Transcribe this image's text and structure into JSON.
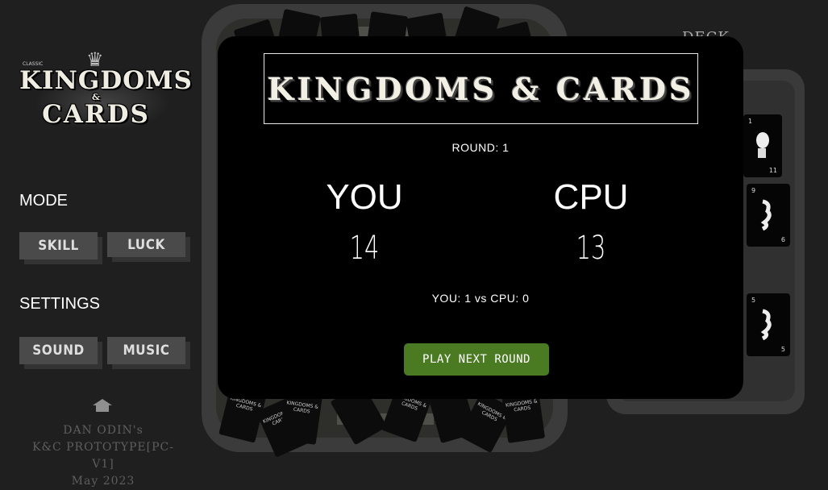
{
  "logo": {
    "tiny": "CLASSIC",
    "line1": "KINGDOMS",
    "line2": "&",
    "line3": "CARDS"
  },
  "sidebar": {
    "mode_title": "MODE",
    "mode_buttons": [
      "SKILL",
      "LUCK"
    ],
    "settings_title": "SETTINGS",
    "settings_buttons": [
      "SOUND",
      "MUSIC"
    ]
  },
  "footer": {
    "line1": "DAN ODIN's",
    "line2": "K&C PROTOTYPE[PC-V1]",
    "line3": "May 2023"
  },
  "deck": {
    "label": "DECK",
    "cards": [
      {
        "top": "1",
        "bottom": "11"
      },
      {
        "top": "9",
        "bottom": "6"
      },
      {
        "top": "5",
        "bottom": "5"
      }
    ]
  },
  "board_cards": [
    "KINGDOMS & CARDS"
  ],
  "modal": {
    "title": "KINGDOMS & CARDS",
    "round_text": "ROUND: 1",
    "player_name": "YOU",
    "player_score": "14",
    "cpu_name": "CPU",
    "cpu_score": "13",
    "tally_text": "YOU: 1 vs CPU: 0",
    "next_button": "PLAY NEXT ROUND"
  },
  "colors": {
    "background": "#1f1f1f",
    "modal": "#000000",
    "accent_button": "#4a7a22",
    "side_button": "#4a4a4a"
  }
}
